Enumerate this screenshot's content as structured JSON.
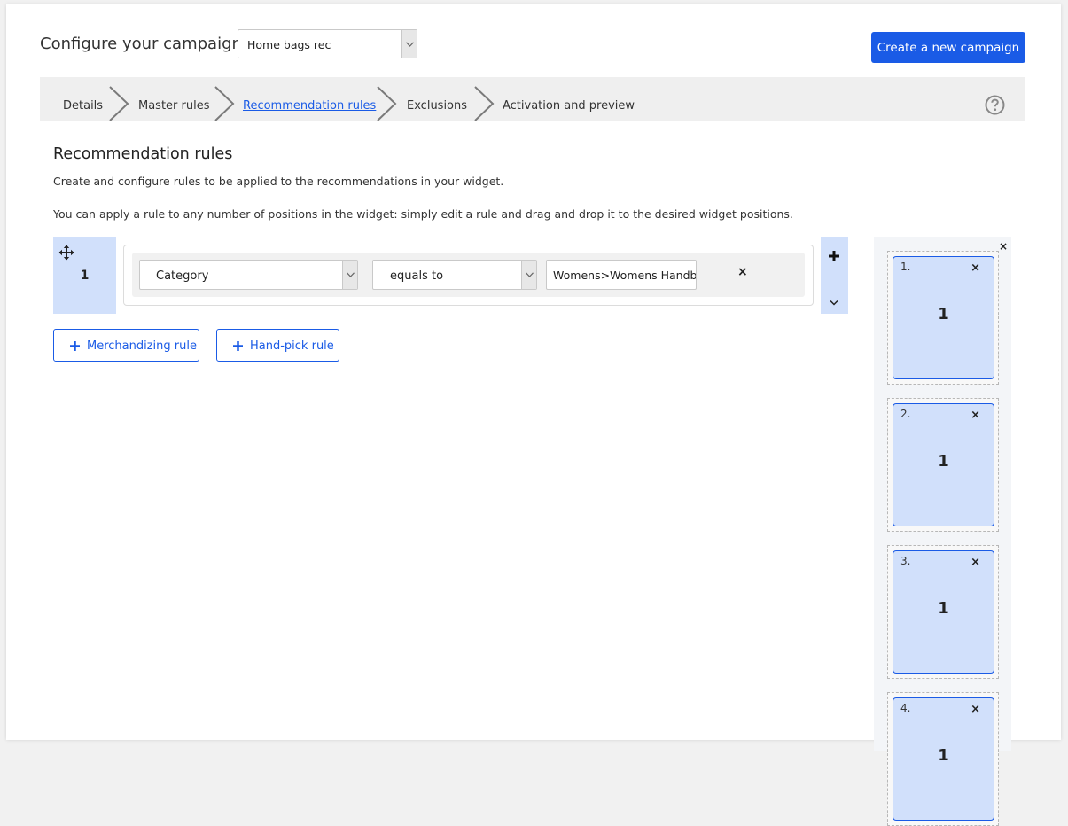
{
  "header": {
    "title": "Configure your campaign",
    "campaign_select_value": "Home bags rec",
    "create_button": "Create a new campaign"
  },
  "steps": [
    {
      "label": "Details",
      "active": false
    },
    {
      "label": "Master rules",
      "active": false
    },
    {
      "label": "Recommendation rules",
      "active": true
    },
    {
      "label": "Exclusions",
      "active": false
    },
    {
      "label": "Activation and preview",
      "active": false
    }
  ],
  "section": {
    "title": "Recommendation rules",
    "description": "Create and configure rules to be applied to the recommendations in your widget.",
    "instruction": "You can apply a rule to any number of positions in the widget: simply edit a rule and drag and drop it to the desired widget positions."
  },
  "rule": {
    "number": "1",
    "field": "Category",
    "operator": "equals to",
    "value": "Womens>Womens Handbags",
    "remove": "×"
  },
  "buttons": {
    "merchandizing": "Merchandizing rule",
    "handpick": "Hand-pick rule"
  },
  "widget": {
    "close": "×",
    "slots": [
      {
        "index": "1.",
        "value": "1",
        "remove": "×"
      },
      {
        "index": "2.",
        "value": "1",
        "remove": "×"
      },
      {
        "index": "3.",
        "value": "1",
        "remove": "×"
      },
      {
        "index": "4.",
        "value": "1",
        "remove": "×"
      }
    ]
  },
  "colors": {
    "accent": "#1a5be6",
    "rule_bg": "#d1e0fb",
    "step_bar": "#efefef"
  },
  "icons": [
    "chevron-down-icon",
    "chevron-right-icon",
    "help-icon",
    "move-icon",
    "plus-icon",
    "close-icon"
  ]
}
